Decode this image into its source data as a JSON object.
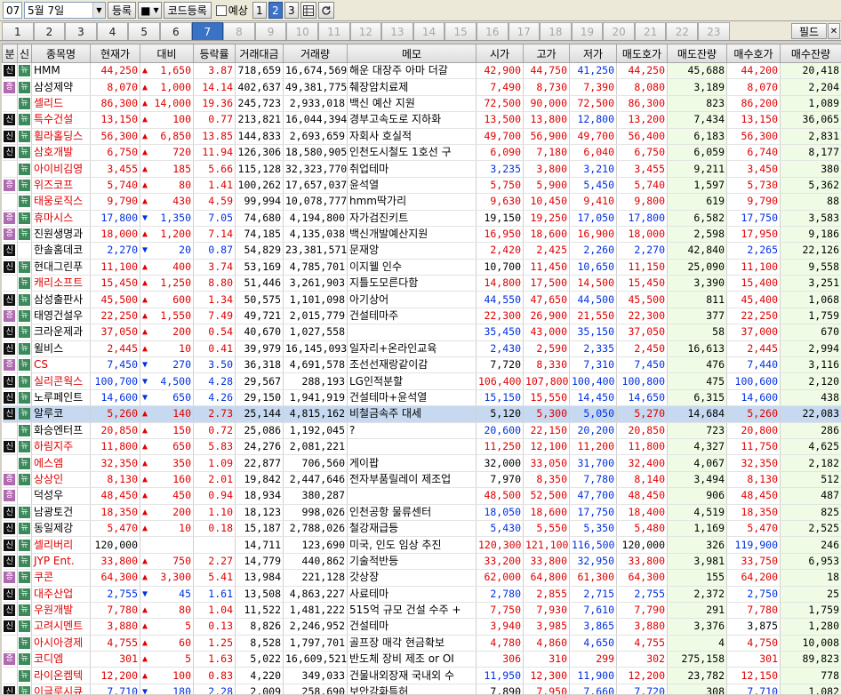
{
  "toolbar": {
    "page_code": "07",
    "date": "5월 7일",
    "register": "등록",
    "stop": "■",
    "code_register": "코드등록",
    "forecast": "예상",
    "view_buttons": [
      "1",
      "2",
      "3"
    ],
    "active_view": "2"
  },
  "tabs": [
    "1",
    "2",
    "3",
    "4",
    "5",
    "6",
    "7",
    "8",
    "9",
    "10",
    "11",
    "12",
    "13",
    "14",
    "15",
    "16",
    "17",
    "18",
    "19",
    "20",
    "21",
    "22",
    "23"
  ],
  "active_tab": "7",
  "filter_label": "필드",
  "columns": [
    "분",
    "신",
    "종목명",
    "현재가",
    "대비",
    "등락률",
    "거래대금",
    "거래량",
    "메모",
    "시가",
    "고가",
    "저가",
    "매도호가",
    "매도잔량",
    "매수호가",
    "매수잔량"
  ],
  "colors": {
    "up": "#e00000",
    "down": "#0030e0",
    "selected": "#c6d9f0",
    "ask_bg": "#f0fbe6",
    "tab_active": "#3a72c6"
  },
  "rows": [
    {
      "b1": "신",
      "b2": "뉴",
      "name": "HMM",
      "name_color": "black",
      "cur": "44,250",
      "dir": "up",
      "chg": "1,650",
      "rate": "3.87",
      "amt": "718,659",
      "vol": "16,674,569",
      "memo": "해운 대장주 아마 더갈",
      "open": "42,900",
      "high": "44,750",
      "low": "41,250",
      "ask": "44,250",
      "ask_q": "45,688",
      "bid": "44,200",
      "bid_q": "20,418"
    },
    {
      "b1": "증",
      "b2": "뉴",
      "name": "삼성제약",
      "name_color": "black",
      "cur": "8,070",
      "dir": "up",
      "chg": "1,000",
      "rate": "14.14",
      "amt": "402,637",
      "vol": "49,381,775",
      "memo": "췌장암치료제",
      "open": "7,490",
      "high": "8,730",
      "low": "7,390",
      "ask": "8,080",
      "ask_q": "3,189",
      "bid": "8,070",
      "bid_q": "2,204"
    },
    {
      "b1": "",
      "b2": "뉴",
      "name": "셀리드",
      "name_color": "red",
      "cur": "86,300",
      "dir": "up",
      "chg": "14,000",
      "rate": "19.36",
      "amt": "245,723",
      "vol": "2,933,018",
      "memo": "백신 예산 지원",
      "open": "72,500",
      "high": "90,000",
      "low": "72,500",
      "ask": "86,300",
      "ask_q": "823",
      "bid": "86,200",
      "bid_q": "1,089"
    },
    {
      "b1": "신",
      "b2": "뉴",
      "name": "특수건설",
      "name_color": "red",
      "cur": "13,150",
      "dir": "up",
      "chg": "100",
      "rate": "0.77",
      "amt": "213,821",
      "vol": "16,044,394",
      "memo": "경부고속도로 지하화",
      "open": "13,500",
      "high": "13,800",
      "low": "12,800",
      "ask": "13,200",
      "ask_q": "7,434",
      "bid": "13,150",
      "bid_q": "36,065"
    },
    {
      "b1": "신",
      "b2": "뉴",
      "name": "휠라홀딩스",
      "name_color": "red",
      "cur": "56,300",
      "dir": "up",
      "chg": "6,850",
      "rate": "13.85",
      "amt": "144,833",
      "vol": "2,693,659",
      "memo": "자회사 호실적",
      "open": "49,700",
      "high": "56,900",
      "low": "49,700",
      "ask": "56,400",
      "ask_q": "6,183",
      "bid": "56,300",
      "bid_q": "2,831"
    },
    {
      "b1": "신",
      "b2": "뉴",
      "name": "삼호개발",
      "name_color": "red",
      "cur": "6,750",
      "dir": "up",
      "chg": "720",
      "rate": "11.94",
      "amt": "126,306",
      "vol": "18,580,905",
      "memo": "인천도시철도 1호선 구",
      "open": "6,090",
      "high": "7,180",
      "low": "6,040",
      "ask": "6,750",
      "ask_q": "6,059",
      "bid": "6,740",
      "bid_q": "8,177"
    },
    {
      "b1": "",
      "b2": "뉴",
      "name": "아이비김영",
      "name_color": "red",
      "cur": "3,455",
      "dir": "up",
      "chg": "185",
      "rate": "5.66",
      "amt": "115,128",
      "vol": "32,323,770",
      "memo": "취업테마",
      "open": "3,235",
      "high": "3,800",
      "low": "3,210",
      "ask": "3,455",
      "ask_q": "9,211",
      "bid": "3,450",
      "bid_q": "380"
    },
    {
      "b1": "증",
      "b2": "뉴",
      "name": "위즈코프",
      "name_color": "red",
      "cur": "5,740",
      "dir": "up",
      "chg": "80",
      "rate": "1.41",
      "amt": "100,262",
      "vol": "17,657,037",
      "memo": "윤석열",
      "open": "5,750",
      "high": "5,900",
      "low": "5,450",
      "ask": "5,740",
      "ask_q": "1,597",
      "bid": "5,730",
      "bid_q": "5,362"
    },
    {
      "b1": "",
      "b2": "뉴",
      "name": "태웅로직스",
      "name_color": "red",
      "cur": "9,790",
      "dir": "up",
      "chg": "430",
      "rate": "4.59",
      "amt": "99,994",
      "vol": "10,078,777",
      "memo": "hmm딱가리",
      "open": "9,630",
      "high": "10,450",
      "low": "9,410",
      "ask": "9,800",
      "ask_q": "619",
      "bid": "9,790",
      "bid_q": "88"
    },
    {
      "b1": "증",
      "b2": "뉴",
      "name": "휴마시스",
      "name_color": "red",
      "cur": "17,800",
      "dir": "down",
      "chg": "1,350",
      "rate": "7.05",
      "amt": "74,680",
      "vol": "4,194,800",
      "memo": "자가검진키트",
      "open": "19,150",
      "high": "19,250",
      "low": "17,050",
      "ask": "17,800",
      "ask_q": "6,582",
      "bid": "17,750",
      "bid_q": "3,583"
    },
    {
      "b1": "증",
      "b2": "뉴",
      "name": "진원생명과",
      "name_color": "black",
      "cur": "18,000",
      "dir": "up",
      "chg": "1,200",
      "rate": "7.14",
      "amt": "74,185",
      "vol": "4,135,038",
      "memo": "백신개발예산지원",
      "open": "16,950",
      "high": "18,600",
      "low": "16,900",
      "ask": "18,000",
      "ask_q": "2,598",
      "bid": "17,950",
      "bid_q": "9,186"
    },
    {
      "b1": "신",
      "b2": "",
      "name": "한솔홈데코",
      "name_color": "black",
      "cur": "2,270",
      "dir": "down",
      "chg": "20",
      "rate": "0.87",
      "amt": "54,829",
      "vol": "23,381,571",
      "memo": "문재앙",
      "open": "2,420",
      "high": "2,425",
      "low": "2,260",
      "ask": "2,270",
      "ask_q": "42,840",
      "bid": "2,265",
      "bid_q": "22,126"
    },
    {
      "b1": "신",
      "b2": "뉴",
      "name": "현대그린푸",
      "name_color": "black",
      "cur": "11,100",
      "dir": "up",
      "chg": "400",
      "rate": "3.74",
      "amt": "53,169",
      "vol": "4,785,701",
      "memo": "이지웰 인수",
      "open": "10,700",
      "high": "11,450",
      "low": "10,650",
      "ask": "11,150",
      "ask_q": "25,090",
      "bid": "11,100",
      "bid_q": "9,558"
    },
    {
      "b1": "",
      "b2": "뉴",
      "name": "캐리소프트",
      "name_color": "red",
      "cur": "15,450",
      "dir": "up",
      "chg": "1,250",
      "rate": "8.80",
      "amt": "51,446",
      "vol": "3,261,903",
      "memo": "지틀도모른다함",
      "open": "14,800",
      "high": "17,500",
      "low": "14,500",
      "ask": "15,450",
      "ask_q": "3,390",
      "bid": "15,400",
      "bid_q": "3,251"
    },
    {
      "b1": "신",
      "b2": "뉴",
      "name": "삼성출판사",
      "name_color": "black",
      "cur": "45,500",
      "dir": "up",
      "chg": "600",
      "rate": "1.34",
      "amt": "50,575",
      "vol": "1,101,098",
      "memo": "아기상어",
      "open": "44,550",
      "high": "47,650",
      "low": "44,500",
      "ask": "45,500",
      "ask_q": "811",
      "bid": "45,400",
      "bid_q": "1,068"
    },
    {
      "b1": "증",
      "b2": "뉴",
      "name": "태영건설우",
      "name_color": "black",
      "cur": "22,250",
      "dir": "up",
      "chg": "1,550",
      "rate": "7.49",
      "amt": "49,721",
      "vol": "2,015,779",
      "memo": "건설테마주",
      "open": "22,300",
      "high": "26,900",
      "low": "21,550",
      "ask": "22,300",
      "ask_q": "377",
      "bid": "22,250",
      "bid_q": "1,759"
    },
    {
      "b1": "신",
      "b2": "뉴",
      "name": "크라운제과",
      "name_color": "black",
      "cur": "37,050",
      "dir": "up",
      "chg": "200",
      "rate": "0.54",
      "amt": "40,670",
      "vol": "1,027,558",
      "memo": "",
      "open": "35,450",
      "high": "43,000",
      "low": "35,150",
      "ask": "37,050",
      "ask_q": "58",
      "bid": "37,000",
      "bid_q": "670"
    },
    {
      "b1": "신",
      "b2": "뉴",
      "name": "윌비스",
      "name_color": "black",
      "cur": "2,445",
      "dir": "up",
      "chg": "10",
      "rate": "0.41",
      "amt": "39,979",
      "vol": "16,145,093",
      "memo": "일자리+온라인교육",
      "open": "2,430",
      "high": "2,590",
      "low": "2,335",
      "ask": "2,450",
      "ask_q": "16,613",
      "bid": "2,445",
      "bid_q": "2,994"
    },
    {
      "b1": "증",
      "b2": "뉴",
      "name": "CS",
      "name_color": "red",
      "cur": "7,450",
      "dir": "down",
      "chg": "270",
      "rate": "3.50",
      "amt": "36,318",
      "vol": "4,691,578",
      "memo": "조선선재랑같이감",
      "open": "7,720",
      "high": "8,330",
      "low": "7,310",
      "ask": "7,450",
      "ask_q": "476",
      "bid": "7,440",
      "bid_q": "3,116"
    },
    {
      "b1": "신",
      "b2": "뉴",
      "name": "실리콘웍스",
      "name_color": "red",
      "cur": "100,700",
      "dir": "down",
      "chg": "4,500",
      "rate": "4.28",
      "amt": "29,567",
      "vol": "288,193",
      "memo": "LG인적분할",
      "open": "106,400",
      "high": "107,800",
      "low": "100,400",
      "ask": "100,800",
      "ask_q": "475",
      "bid": "100,600",
      "bid_q": "2,120"
    },
    {
      "b1": "신",
      "b2": "뉴",
      "name": "노루페인트",
      "name_color": "black",
      "cur": "14,600",
      "dir": "down",
      "chg": "650",
      "rate": "4.26",
      "amt": "29,150",
      "vol": "1,941,919",
      "memo": "건설테마+윤석열",
      "open": "15,150",
      "high": "15,550",
      "low": "14,450",
      "ask": "14,650",
      "ask_q": "6,315",
      "bid": "14,600",
      "bid_q": "438"
    },
    {
      "b1": "신",
      "b2": "뉴",
      "name": "알루코",
      "name_color": "black",
      "cur": "5,260",
      "dir": "up",
      "chg": "140",
      "rate": "2.73",
      "amt": "25,144",
      "vol": "4,815,162",
      "memo": "비철금속주 대세",
      "open": "5,120",
      "high": "5,300",
      "low": "5,050",
      "ask": "5,270",
      "ask_q": "14,684",
      "bid": "5,260",
      "bid_q": "22,083",
      "selected": true
    },
    {
      "b1": "",
      "b2": "뉴",
      "name": "화승엔터프",
      "name_color": "black",
      "cur": "20,850",
      "dir": "up",
      "chg": "150",
      "rate": "0.72",
      "amt": "25,086",
      "vol": "1,192,045",
      "memo": "?",
      "open": "20,600",
      "high": "22,150",
      "low": "20,200",
      "ask": "20,850",
      "ask_q": "723",
      "bid": "20,800",
      "bid_q": "286"
    },
    {
      "b1": "신",
      "b2": "뉴",
      "name": "하림지주",
      "name_color": "red",
      "cur": "11,800",
      "dir": "up",
      "chg": "650",
      "rate": "5.83",
      "amt": "24,276",
      "vol": "2,081,221",
      "memo": "",
      "open": "11,250",
      "high": "12,100",
      "low": "11,200",
      "ask": "11,800",
      "ask_q": "4,327",
      "bid": "11,750",
      "bid_q": "4,625"
    },
    {
      "b1": "",
      "b2": "뉴",
      "name": "에스엠",
      "name_color": "red",
      "cur": "32,350",
      "dir": "up",
      "chg": "350",
      "rate": "1.09",
      "amt": "22,877",
      "vol": "706,560",
      "memo": "게이팝",
      "open": "32,000",
      "high": "33,050",
      "low": "31,700",
      "ask": "32,400",
      "ask_q": "4,067",
      "bid": "32,350",
      "bid_q": "2,182"
    },
    {
      "b1": "증",
      "b2": "뉴",
      "name": "상상인",
      "name_color": "red",
      "cur": "8,130",
      "dir": "up",
      "chg": "160",
      "rate": "2.01",
      "amt": "19,842",
      "vol": "2,447,646",
      "memo": "전자부품릴레이 제조업",
      "open": "7,970",
      "high": "8,350",
      "low": "7,780",
      "ask": "8,140",
      "ask_q": "3,494",
      "bid": "8,130",
      "bid_q": "512"
    },
    {
      "b1": "증",
      "b2": "",
      "name": "덕성우",
      "name_color": "black",
      "cur": "48,450",
      "dir": "up",
      "chg": "450",
      "rate": "0.94",
      "amt": "18,934",
      "vol": "380,287",
      "memo": "",
      "open": "48,500",
      "high": "52,500",
      "low": "47,700",
      "ask": "48,450",
      "ask_q": "906",
      "bid": "48,450",
      "bid_q": "487"
    },
    {
      "b1": "신",
      "b2": "뉴",
      "name": "남광토건",
      "name_color": "black",
      "cur": "18,350",
      "dir": "up",
      "chg": "200",
      "rate": "1.10",
      "amt": "18,123",
      "vol": "998,026",
      "memo": "인천공항 물류센터",
      "open": "18,050",
      "high": "18,600",
      "low": "17,750",
      "ask": "18,400",
      "ask_q": "4,519",
      "bid": "18,350",
      "bid_q": "825"
    },
    {
      "b1": "신",
      "b2": "뉴",
      "name": "동일제강",
      "name_color": "black",
      "cur": "5,470",
      "dir": "up",
      "chg": "10",
      "rate": "0.18",
      "amt": "15,187",
      "vol": "2,788,026",
      "memo": "철강재급등",
      "open": "5,430",
      "high": "5,550",
      "low": "5,350",
      "ask": "5,480",
      "ask_q": "1,169",
      "bid": "5,470",
      "bid_q": "2,525"
    },
    {
      "b1": "신",
      "b2": "뉴",
      "name": "셀리버리",
      "name_color": "red",
      "cur": "120,000",
      "dir": "",
      "chg": "",
      "rate": "",
      "amt": "14,711",
      "vol": "123,690",
      "memo": "미국, 인도 임상 추진",
      "open": "120,300",
      "high": "121,100",
      "low": "116,500",
      "ask": "120,000",
      "ask_q": "326",
      "bid": "119,900",
      "bid_q": "246",
      "cur_black": true,
      "ask_black": true
    },
    {
      "b1": "신",
      "b2": "뉴",
      "name": "JYP Ent.",
      "name_color": "red",
      "cur": "33,800",
      "dir": "up",
      "chg": "750",
      "rate": "2.27",
      "amt": "14,779",
      "vol": "440,862",
      "memo": "기술적반등",
      "open": "33,200",
      "high": "33,800",
      "low": "32,950",
      "ask": "33,800",
      "ask_q": "3,981",
      "bid": "33,750",
      "bid_q": "6,953"
    },
    {
      "b1": "증",
      "b2": "뉴",
      "name": "쿠콘",
      "name_color": "red",
      "cur": "64,300",
      "dir": "up",
      "chg": "3,300",
      "rate": "5.41",
      "amt": "13,984",
      "vol": "221,128",
      "memo": "갓상장",
      "open": "62,000",
      "high": "64,800",
      "low": "61,300",
      "ask": "64,300",
      "ask_q": "155",
      "bid": "64,200",
      "bid_q": "18"
    },
    {
      "b1": "신",
      "b2": "뉴",
      "name": "대주산업",
      "name_color": "red",
      "cur": "2,755",
      "dir": "down",
      "chg": "45",
      "rate": "1.61",
      "amt": "13,508",
      "vol": "4,863,227",
      "memo": "사료테마",
      "open": "2,780",
      "high": "2,855",
      "low": "2,715",
      "ask": "2,755",
      "ask_q": "2,372",
      "bid": "2,750",
      "bid_q": "25"
    },
    {
      "b1": "신",
      "b2": "뉴",
      "name": "우원개발",
      "name_color": "red",
      "cur": "7,780",
      "dir": "up",
      "chg": "80",
      "rate": "1.04",
      "amt": "11,522",
      "vol": "1,481,222",
      "memo": "515억 규모 건설 수주 +",
      "open": "7,750",
      "high": "7,930",
      "low": "7,610",
      "ask": "7,790",
      "ask_q": "291",
      "bid": "7,780",
      "bid_q": "1,759"
    },
    {
      "b1": "신",
      "b2": "뉴",
      "name": "고려시멘트",
      "name_color": "red",
      "cur": "3,880",
      "dir": "up",
      "chg": "5",
      "rate": "0.13",
      "amt": "8,826",
      "vol": "2,246,952",
      "memo": "건설테마",
      "open": "3,940",
      "high": "3,985",
      "low": "3,865",
      "ask": "3,880",
      "ask_q": "3,376",
      "bid": "3,875",
      "bid_q": "1,280"
    },
    {
      "b1": "",
      "b2": "뉴",
      "name": "아시아경제",
      "name_color": "red",
      "cur": "4,755",
      "dir": "up",
      "chg": "60",
      "rate": "1.25",
      "amt": "8,528",
      "vol": "1,797,701",
      "memo": "골프장 매각 현금확보",
      "open": "4,780",
      "high": "4,860",
      "low": "4,650",
      "ask": "4,755",
      "ask_q": "4",
      "bid": "4,750",
      "bid_q": "10,008"
    },
    {
      "b1": "증",
      "b2": "뉴",
      "name": "코디엠",
      "name_color": "red",
      "cur": "301",
      "dir": "up",
      "chg": "5",
      "rate": "1.63",
      "amt": "5,022",
      "vol": "16,609,521",
      "memo": "반도체 장비 제조 or OI",
      "open": "306",
      "high": "310",
      "low": "299",
      "ask": "302",
      "ask_q": "275,158",
      "bid": "301",
      "bid_q": "89,823"
    },
    {
      "b1": "",
      "b2": "뉴",
      "name": "라이온켐텍",
      "name_color": "red",
      "cur": "12,200",
      "dir": "up",
      "chg": "100",
      "rate": "0.83",
      "amt": "4,220",
      "vol": "349,033",
      "memo": "건물내외장재 국내외 수",
      "open": "11,950",
      "high": "12,300",
      "low": "11,900",
      "ask": "12,200",
      "ask_q": "23,782",
      "bid": "12,150",
      "bid_q": "778"
    },
    {
      "b1": "신",
      "b2": "뉴",
      "name": "이글루시큐",
      "name_color": "red",
      "cur": "7,710",
      "dir": "down",
      "chg": "180",
      "rate": "2.28",
      "amt": "2,009",
      "vol": "258,690",
      "memo": "보안강화특허",
      "open": "7,890",
      "high": "7,950",
      "low": "7,660",
      "ask": "7,720",
      "ask_q": "308",
      "bid": "7,710",
      "bid_q": "1,082"
    }
  ]
}
